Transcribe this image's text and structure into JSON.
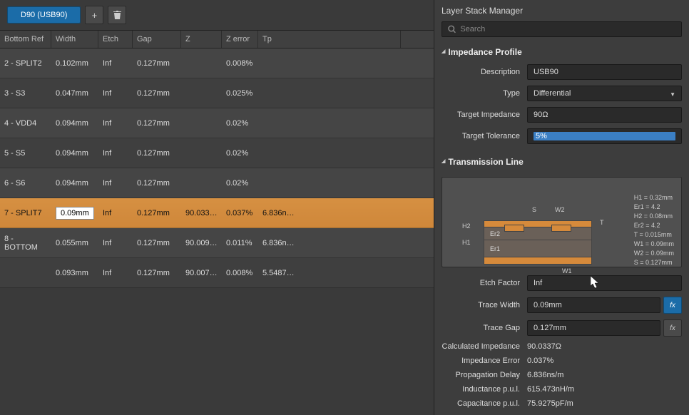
{
  "tabs": {
    "active": "D90 (USB90)"
  },
  "columns": {
    "bottom_ref": "Bottom Ref",
    "width": "Width",
    "etch": "Etch",
    "gap": "Gap",
    "z": "Z",
    "zerr": "Z error",
    "tp": "Tp"
  },
  "rows": [
    {
      "bottom_ref": "2 - SPLIT2",
      "width": "0.102mm",
      "etch": "Inf",
      "gap": "0.127mm",
      "z": "",
      "zerr": "0.008%",
      "tp": ""
    },
    {
      "bottom_ref": "3 - S3",
      "width": "0.047mm",
      "etch": "Inf",
      "gap": "0.127mm",
      "z": "",
      "zerr": "0.025%",
      "tp": ""
    },
    {
      "bottom_ref": "4 - VDD4",
      "width": "0.094mm",
      "etch": "Inf",
      "gap": "0.127mm",
      "z": "",
      "zerr": "0.02%",
      "tp": ""
    },
    {
      "bottom_ref": "5 - S5",
      "width": "0.094mm",
      "etch": "Inf",
      "gap": "0.127mm",
      "z": "",
      "zerr": "0.02%",
      "tp": ""
    },
    {
      "bottom_ref": "6 - S6",
      "width": "0.094mm",
      "etch": "Inf",
      "gap": "0.127mm",
      "z": "",
      "zerr": "0.02%",
      "tp": ""
    },
    {
      "bottom_ref": "7 - SPLIT7",
      "width": "0.09mm",
      "etch": "Inf",
      "gap": "0.127mm",
      "z": "90.033…",
      "zerr": "0.037%",
      "tp": "6.836n…",
      "selected": true
    },
    {
      "bottom_ref": "8 - BOTTOM",
      "width": "0.055mm",
      "etch": "Inf",
      "gap": "0.127mm",
      "z": "90.009…",
      "zerr": "0.011%",
      "tp": "6.836n…"
    },
    {
      "bottom_ref": "",
      "width": "0.093mm",
      "etch": "Inf",
      "gap": "0.127mm",
      "z": "90.007…",
      "zerr": "0.008%",
      "tp": "5.5487…"
    }
  ],
  "panel": {
    "title": "Layer Stack Manager",
    "search_placeholder": "Search"
  },
  "profile": {
    "header": "Impedance Profile",
    "description_label": "Description",
    "description": "USB90",
    "type_label": "Type",
    "type": "Differential",
    "target_z_label": "Target Impedance",
    "target_z": "90Ω",
    "target_tol_label": "Target Tolerance",
    "target_tol": "5%"
  },
  "tline": {
    "header": "Transmission Line",
    "dims": {
      "S": "S",
      "W2": "W2",
      "T": "T",
      "H2": "H2",
      "H1": "H1",
      "W1": "W1",
      "Er2": "Er2",
      "Er1": "Er1"
    },
    "vals": [
      "H1 = 0.32mm",
      "Er1 = 4.2",
      "H2 = 0.08mm",
      "Er2 = 4.2",
      "T = 0.015mm",
      "W1 = 0.09mm",
      "W2 = 0.09mm",
      "S = 0.127mm"
    ],
    "etch_label": "Etch Factor",
    "etch": "Inf",
    "trace_w_label": "Trace Width",
    "trace_w": "0.09mm",
    "trace_g_label": "Trace Gap",
    "trace_g": "0.127mm",
    "calc_z_label": "Calculated Impedance",
    "calc_z": "90.0337Ω",
    "z_err_label": "Impedance Error",
    "z_err": "0.037%",
    "prop_delay_label": "Propagation Delay",
    "prop_delay": "6.836ns/m",
    "ind_label": "Inductance p.u.l.",
    "ind": "615.473nH/m",
    "cap_label": "Capacitance p.u.l.",
    "cap": "75.9275pF/m"
  }
}
